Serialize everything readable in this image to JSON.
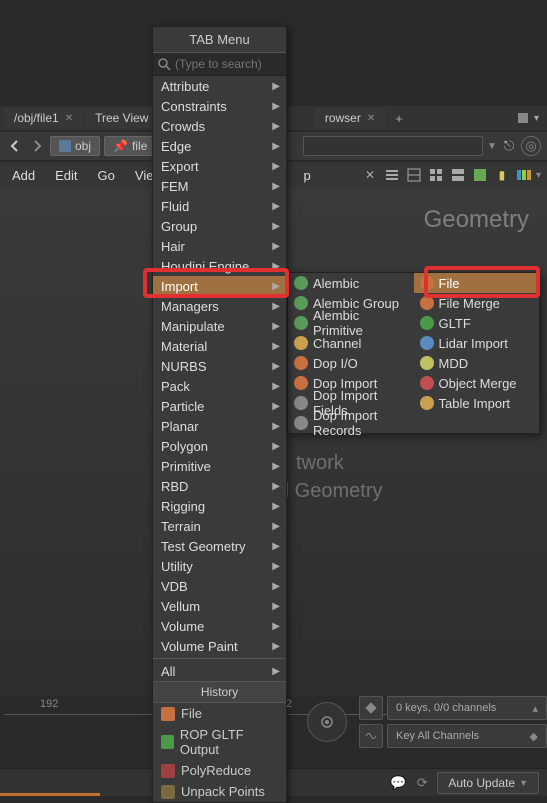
{
  "tabmenu": {
    "title": "TAB Menu",
    "search_placeholder": "(Type to search)",
    "items": [
      "Attribute",
      "Constraints",
      "Crowds",
      "Edge",
      "Export",
      "FEM",
      "Fluid",
      "Group",
      "Hair",
      "Houdini Engine",
      "Import",
      "Managers",
      "Manipulate",
      "Material",
      "NURBS",
      "Pack",
      "Particle",
      "Planar",
      "Polygon",
      "Primitive",
      "RBD",
      "Rigging",
      "Terrain",
      "Test Geometry",
      "Utility",
      "VDB",
      "Vellum",
      "Volume",
      "Volume Paint"
    ],
    "highlighted_index": 10,
    "all_label": "All",
    "history_label": "History",
    "history": [
      "File",
      "ROP GLTF Output",
      "PolyReduce",
      "Unpack Points"
    ]
  },
  "submenu": {
    "col1": [
      "Alembic",
      "Alembic Group",
      "Alembic Primitive",
      "Channel",
      "Dop I/O",
      "Dop Import",
      "Dop Import Fields",
      "Dop Import Records"
    ],
    "col2": [
      "File",
      "File Merge",
      "GLTF",
      "Lidar Import",
      "MDD",
      "Object Merge",
      "Table Import"
    ],
    "highlighted": "File"
  },
  "tabs": {
    "t1": "/obj/file1",
    "t2": "Tree View",
    "t3": "rowser"
  },
  "breadcrumb": {
    "obj": "obj",
    "file": "file"
  },
  "menubar": {
    "add": "Add",
    "edit": "Edit",
    "go": "Go",
    "view": "Vie",
    "help": "p"
  },
  "main": {
    "geometry": "Geometry",
    "network": "twork",
    "geo_line": "d Geometry"
  },
  "timeline": {
    "frame": "192",
    "ruler_end": "2"
  },
  "keys_panel": {
    "line1": "0 keys, 0/0 channels",
    "line2": "Key All Channels"
  },
  "status": {
    "auto_update": "Auto Update"
  }
}
